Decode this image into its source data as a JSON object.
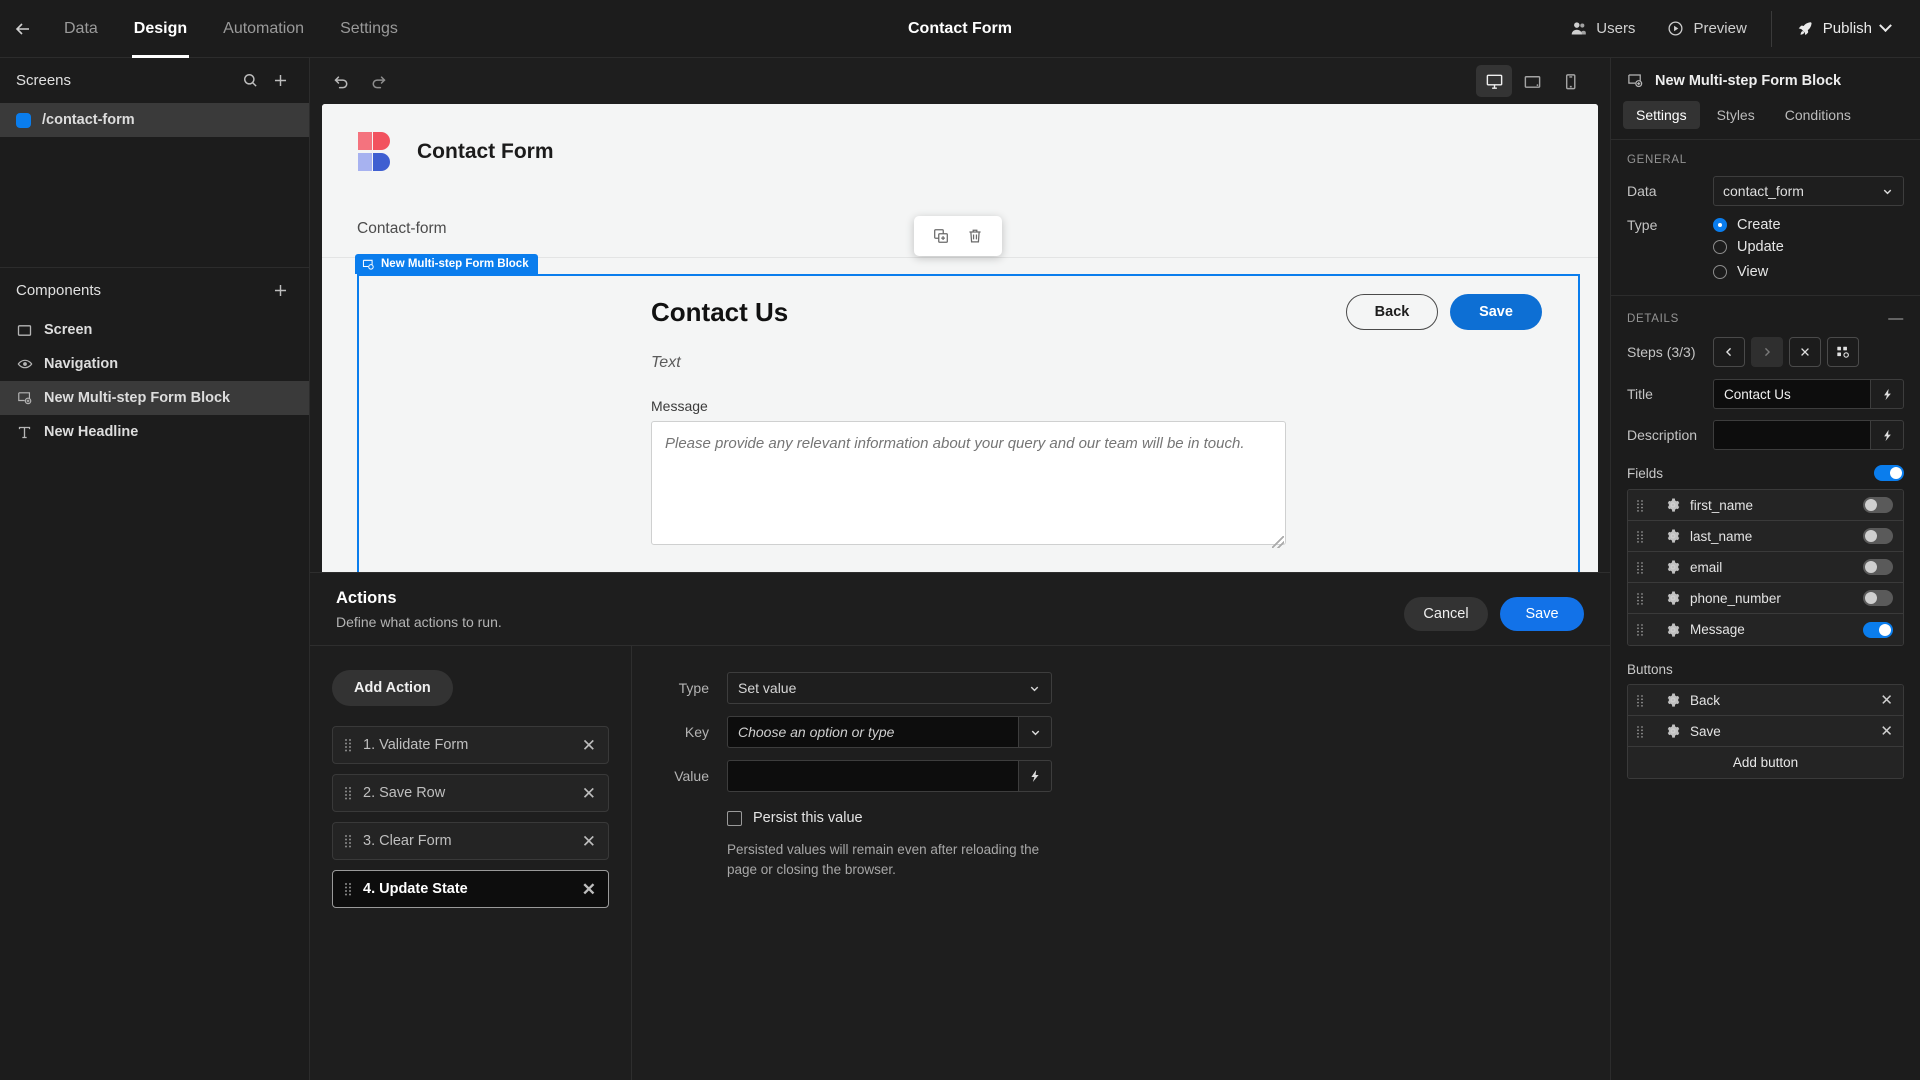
{
  "topbar": {
    "back_icon": "arrow-left-icon",
    "tabs": [
      {
        "label": "Data",
        "active": false
      },
      {
        "label": "Design",
        "active": true
      },
      {
        "label": "Automation",
        "active": false
      },
      {
        "label": "Settings",
        "active": false
      }
    ],
    "title": "Contact Form",
    "users_label": "Users",
    "preview_label": "Preview",
    "publish_label": "Publish"
  },
  "sidebar": {
    "screens_header": "Screens",
    "screens": [
      {
        "label": "/contact-form",
        "selected": true,
        "color": "#0a7ded"
      }
    ],
    "components_header": "Components",
    "components": [
      {
        "label": "Screen",
        "icon": "screen-icon",
        "selected": false
      },
      {
        "label": "Navigation",
        "icon": "eye-icon",
        "selected": false
      },
      {
        "label": "New Multi-step Form Block",
        "icon": "form-block-icon",
        "selected": true
      },
      {
        "label": "New Headline",
        "icon": "text-icon",
        "selected": false
      }
    ]
  },
  "canvas_toolbar": {
    "undo": "undo-icon",
    "redo": "redo-icon",
    "devices": [
      {
        "name": "desktop",
        "active": true
      },
      {
        "name": "tablet",
        "active": false
      },
      {
        "name": "mobile",
        "active": false
      }
    ]
  },
  "preview": {
    "app_title": "Contact Form",
    "nav_item": "Contact-form",
    "block_badge": "New Multi-step Form Block",
    "form": {
      "title": "Contact Us",
      "back_label": "Back",
      "save_label": "Save",
      "description_placeholder": "Text",
      "message_label": "Message",
      "message_placeholder": "Please provide any relevant information about your query and our team will be in touch."
    }
  },
  "actions": {
    "title": "Actions",
    "subtitle": "Define what actions to run.",
    "cancel_label": "Cancel",
    "save_label": "Save",
    "add_action_label": "Add Action",
    "items": [
      {
        "label": "1. Validate Form",
        "selected": false
      },
      {
        "label": "2. Save Row",
        "selected": false
      },
      {
        "label": "3. Clear Form",
        "selected": false
      },
      {
        "label": "4. Update State",
        "selected": true
      }
    ],
    "detail": {
      "type_label": "Type",
      "type_value": "Set value",
      "key_label": "Key",
      "key_placeholder": "Choose an option or type",
      "value_label": "Value",
      "value_value": "",
      "persist_label": "Persist this value",
      "persist_checked": false,
      "persist_help": "Persisted values will remain even after reloading the page or closing the browser."
    }
  },
  "inspector": {
    "header_title": "New Multi-step Form Block",
    "header_icon": "form-block-icon",
    "tabs": [
      {
        "label": "Settings",
        "active": true
      },
      {
        "label": "Styles",
        "active": false
      },
      {
        "label": "Conditions",
        "active": false
      }
    ],
    "general_title": "GENERAL",
    "data_label": "Data",
    "data_value": "contact_form",
    "type_label": "Type",
    "type_options": [
      {
        "label": "Create",
        "selected": true
      },
      {
        "label": "Update",
        "selected": false
      },
      {
        "label": "View",
        "selected": false
      }
    ],
    "details_title": "DETAILS",
    "steps_label": "Steps (3/3)",
    "steps_buttons": [
      "prev",
      "next",
      "delete",
      "manage"
    ],
    "title_label": "Title",
    "title_value": "Contact Us",
    "description_label": "Description",
    "description_value": "",
    "fields_label": "Fields",
    "fields_master_on": true,
    "fields": [
      {
        "label": "first_name",
        "on": false
      },
      {
        "label": "last_name",
        "on": false
      },
      {
        "label": "email",
        "on": false
      },
      {
        "label": "phone_number",
        "on": false
      },
      {
        "label": "Message",
        "on": true
      }
    ],
    "buttons_label": "Buttons",
    "buttons": [
      {
        "label": "Back"
      },
      {
        "label": "Save"
      }
    ],
    "add_button_label": "Add button"
  },
  "colors": {
    "accent": "#0a7ded",
    "primary_button": "#0d6fd4",
    "panel": "#1c1c1c",
    "canvas": "#f4f5f5"
  }
}
